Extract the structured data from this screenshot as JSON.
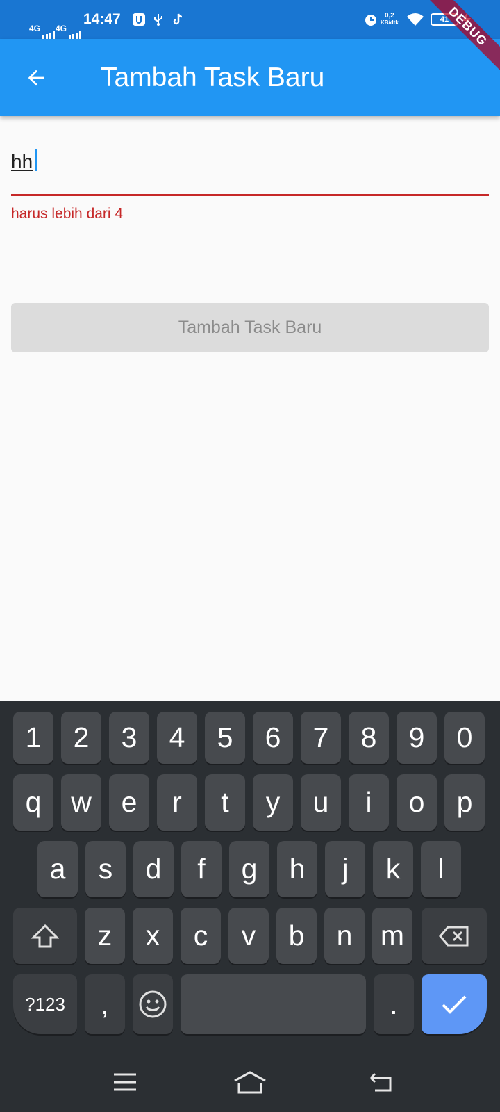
{
  "status_bar": {
    "network_1": "4G",
    "network_2": "4G",
    "time": "14:47",
    "net_speed_value": "0,2",
    "net_speed_unit": "KB/dtk",
    "battery": "41"
  },
  "debug_banner": "DEBUG",
  "app_bar": {
    "title": "Tambah Task Baru",
    "back_icon": "arrow-back-icon"
  },
  "form": {
    "input_value": "hh",
    "error_text": "harus lebih dari 4",
    "submit_label": "Tambah Task Baru"
  },
  "colors": {
    "status_bar": "#1976d2",
    "app_bar": "#2196f3",
    "error": "#c62828",
    "disabled_button": "#dcdcdc",
    "keyboard_bg": "#2b2f33",
    "key": "#474a4e",
    "enter_key": "#5e97f6"
  },
  "keyboard": {
    "row_numbers": [
      "1",
      "2",
      "3",
      "4",
      "5",
      "6",
      "7",
      "8",
      "9",
      "0"
    ],
    "row_top": [
      "q",
      "w",
      "e",
      "r",
      "t",
      "y",
      "u",
      "i",
      "o",
      "p"
    ],
    "row_middle": [
      "a",
      "s",
      "d",
      "f",
      "g",
      "h",
      "j",
      "k",
      "l"
    ],
    "row_bottom": [
      "z",
      "x",
      "c",
      "v",
      "b",
      "n",
      "m"
    ],
    "symbols_label": "?123",
    "comma": ",",
    "period": ".",
    "shift_icon": "shift-icon",
    "backspace_icon": "backspace-icon",
    "emoji_icon": "emoji-icon",
    "enter_icon": "check-icon"
  },
  "nav_bar": {
    "icons": [
      "menu-icon",
      "home-icon",
      "back-icon"
    ]
  }
}
